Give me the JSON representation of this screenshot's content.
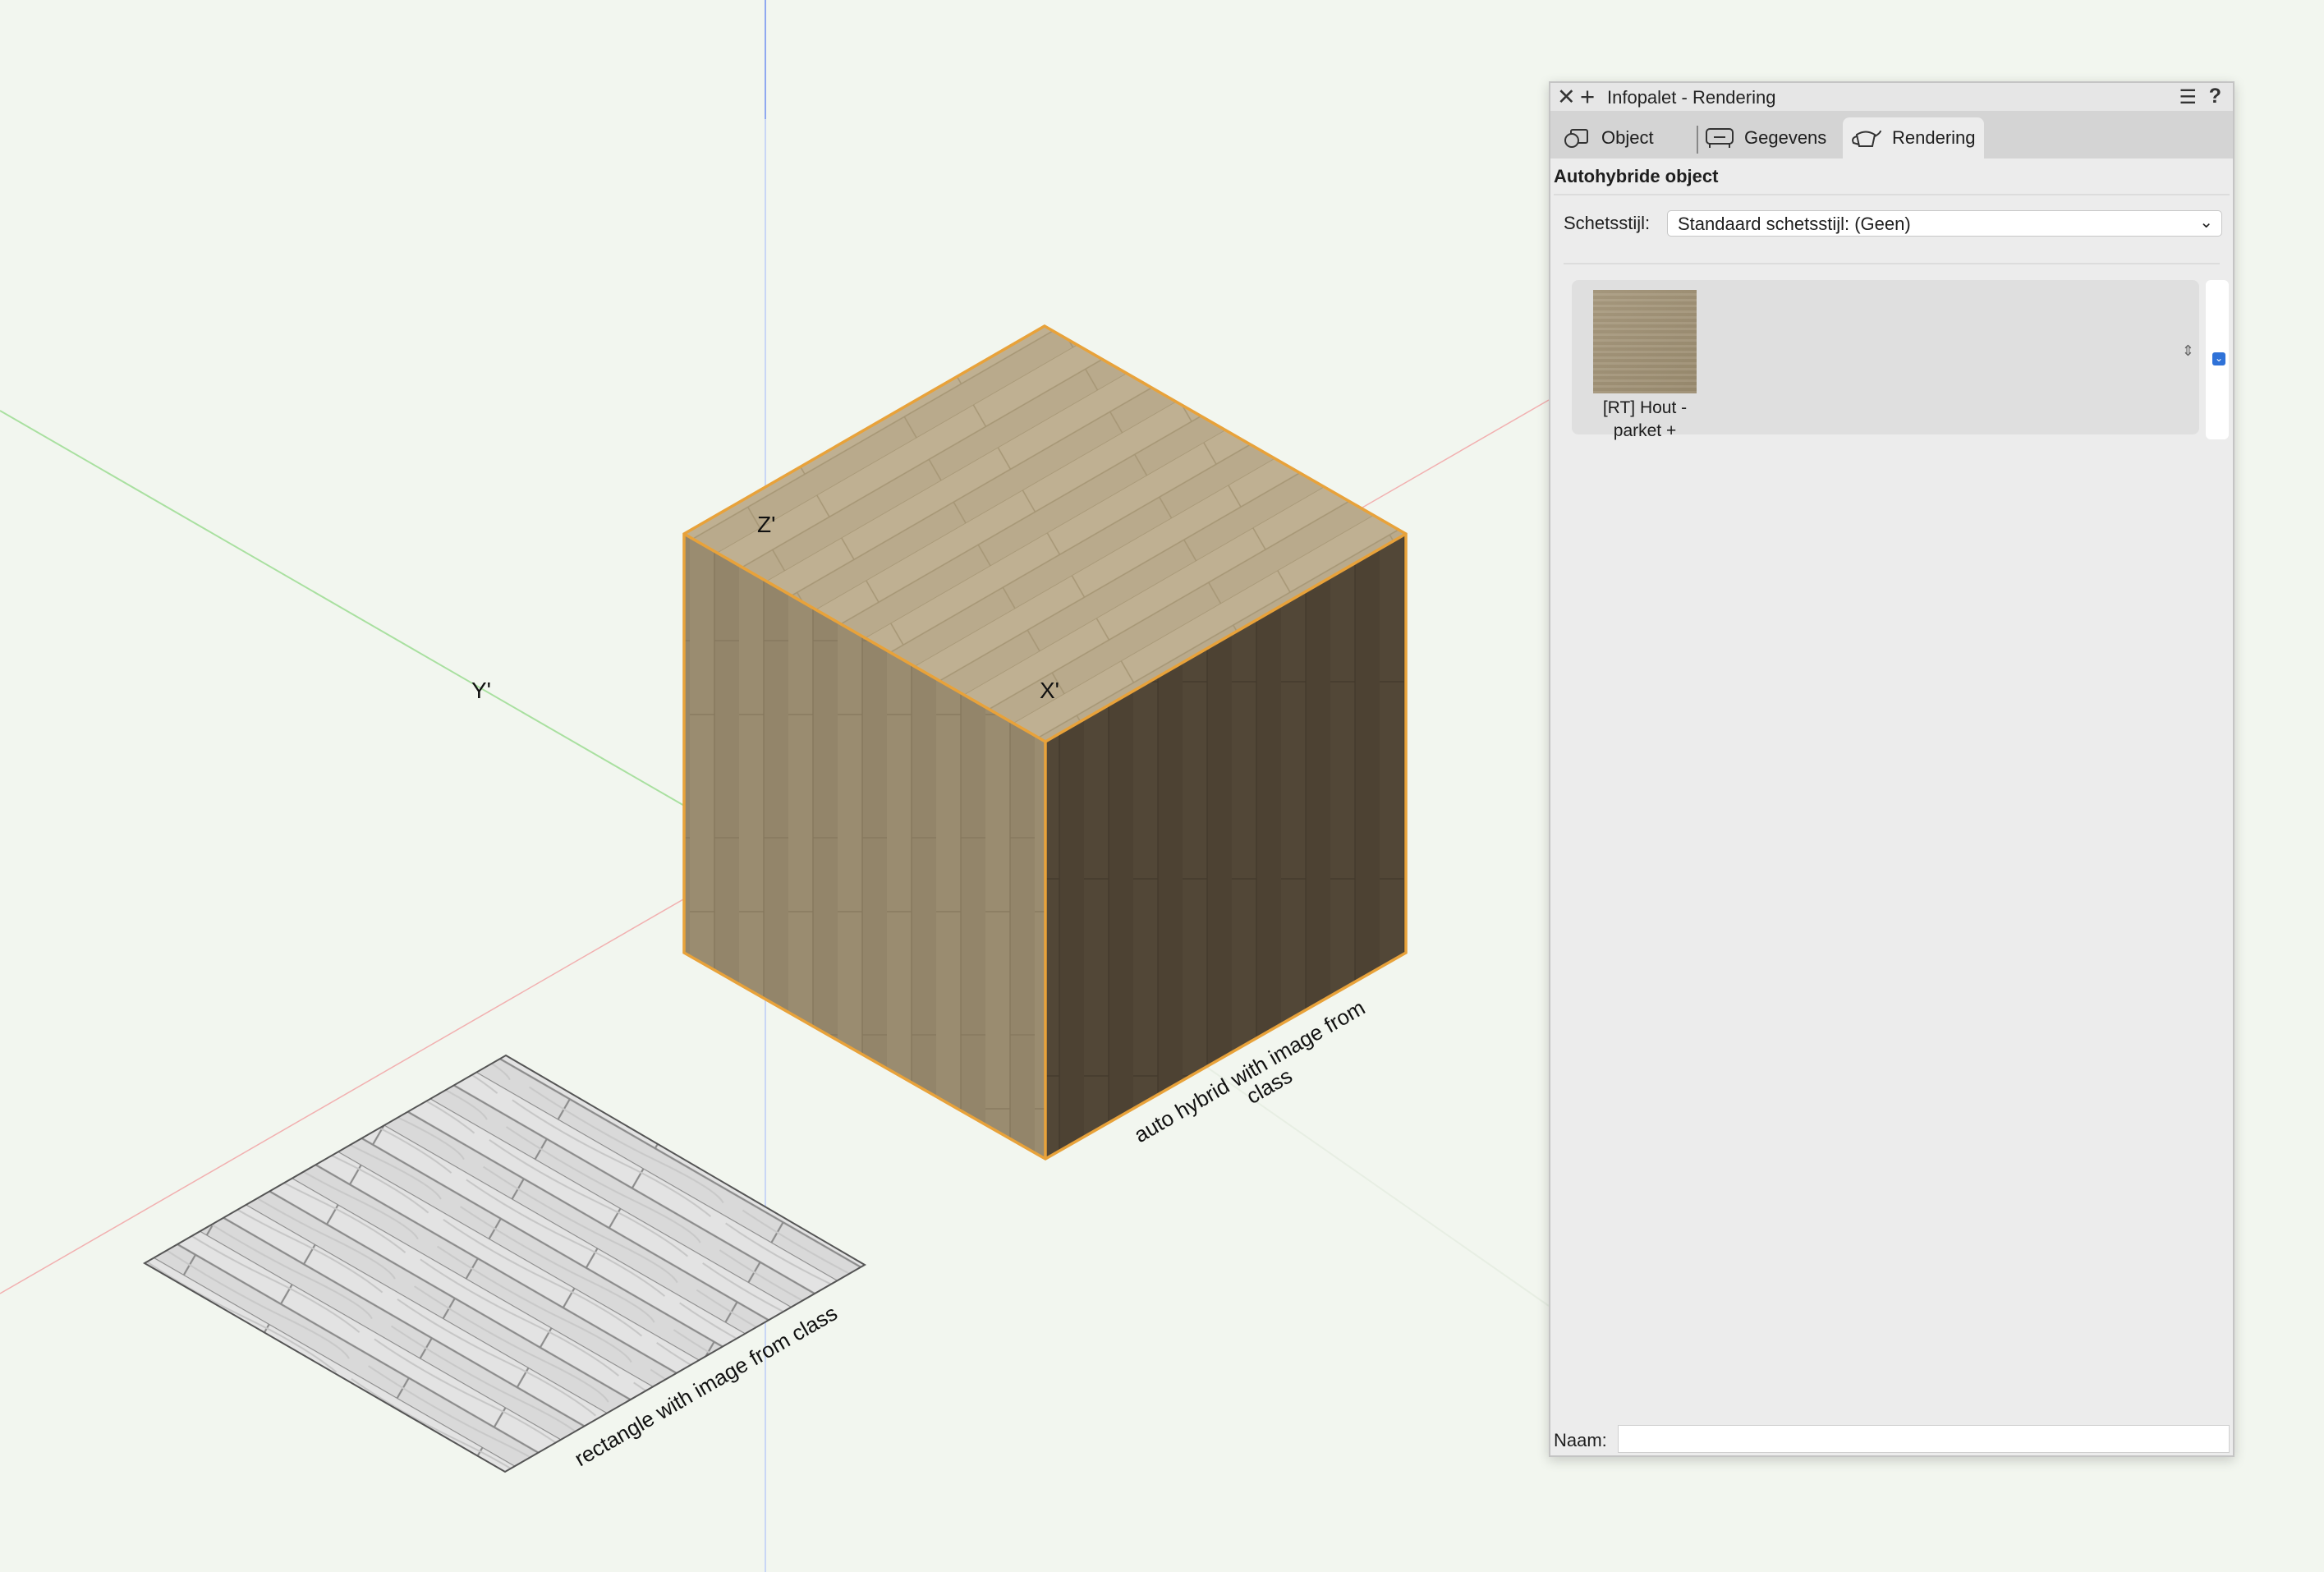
{
  "viewport": {
    "axis_labels": {
      "z": "Z'",
      "y": "Y'",
      "x": "X'"
    },
    "captions": {
      "cube_line1": "auto hybrid with image from",
      "cube_line2": "class",
      "rectangle": "rectangle with image from class"
    }
  },
  "palette": {
    "title": "Infopalet - Rendering",
    "icons": {
      "close": "close-icon",
      "add": "plus-icon",
      "menu": "menu-icon",
      "help": "help-icon"
    },
    "tabs": [
      {
        "label": "Object",
        "icon": "object-icon"
      },
      {
        "label": "Gegevens",
        "icon": "data-icon"
      },
      {
        "label": "Rendering",
        "icon": "teapot-icon",
        "active": true
      }
    ],
    "section_title": "Autohybride object",
    "sketch_style": {
      "label": "Schetsstijl:",
      "value": "Standaard schetsstijl: (Geen)"
    },
    "texture": {
      "label_line1": "[RT] Hout -",
      "label_line2": "parket +"
    },
    "name_field": {
      "label": "Naam:",
      "value": ""
    }
  },
  "colors": {
    "background": "#f2f6ef",
    "selection_outline": "#e8a23a",
    "axis_blue": "#8fa8f0",
    "axis_green": "#a9e0a0",
    "axis_red": "#f2b0b0",
    "active_blue": "#2f72d8"
  }
}
